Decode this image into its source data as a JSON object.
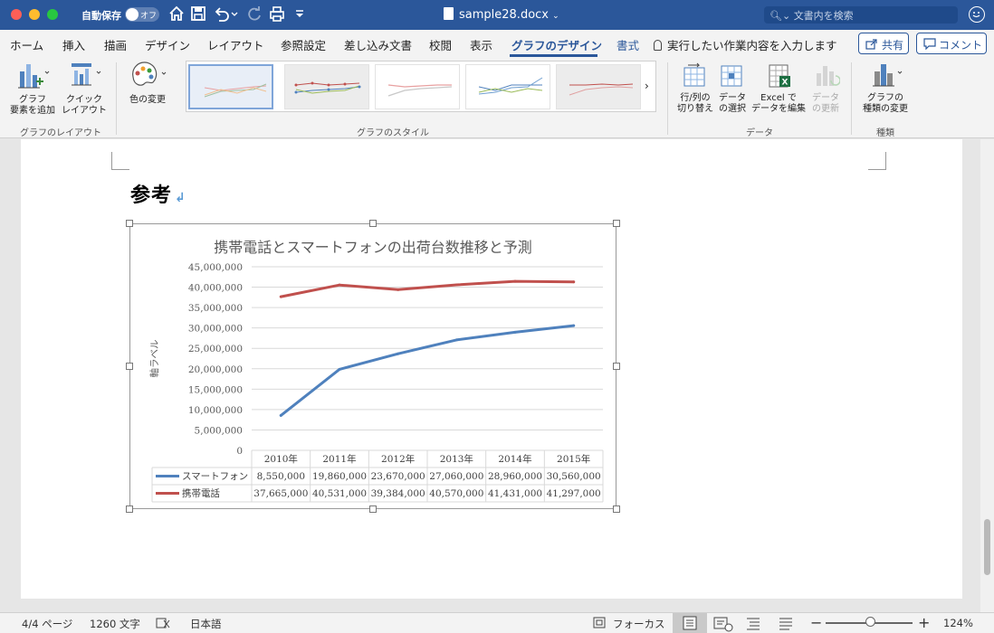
{
  "titlebar": {
    "autosave_label": "自動保存",
    "autosave_state": "オフ",
    "document_name": "sample28.docx",
    "search_placeholder": "文書内を検索"
  },
  "tabs": [
    {
      "label": "ホーム",
      "active": false
    },
    {
      "label": "挿入",
      "active": false
    },
    {
      "label": "描画",
      "active": false
    },
    {
      "label": "デザイン",
      "active": false
    },
    {
      "label": "レイアウト",
      "active": false
    },
    {
      "label": "参照設定",
      "active": false
    },
    {
      "label": "差し込み文書",
      "active": false
    },
    {
      "label": "校閲",
      "active": false
    },
    {
      "label": "表示",
      "active": false
    },
    {
      "label": "グラフのデザイン",
      "active": true
    },
    {
      "label": "書式",
      "active": false,
      "accent": true
    }
  ],
  "tell_me": "実行したい作業内容を入力します",
  "share_label": "共有",
  "comment_label": "コメント",
  "ribbon": {
    "add_element": [
      "グラフ",
      "要素を追加"
    ],
    "quick_layout": [
      "クイック",
      "レイアウト"
    ],
    "group_layout": "グラフのレイアウト",
    "change_colors": "色の変更",
    "group_styles": "グラフのスタイル",
    "switch_row_col": [
      "行/列の",
      "切り替え"
    ],
    "select_data": [
      "データ",
      "の選択"
    ],
    "edit_in_excel": [
      "Excel で",
      "データを編集"
    ],
    "refresh_data": [
      "データ",
      "の更新"
    ],
    "group_data": "データ",
    "change_type": [
      "グラフの",
      "種類の変更"
    ],
    "group_type": "種類"
  },
  "document": {
    "heading": "参考",
    "return_mark": "↲"
  },
  "chart_data": {
    "type": "line",
    "title": "携帯電話とスマートフォンの出荷台数推移と予測",
    "ylabel": "軸ラベル",
    "xlabel": "",
    "categories": [
      "2010年",
      "2011年",
      "2012年",
      "2013年",
      "2014年",
      "2015年"
    ],
    "ylim": [
      0,
      45000000
    ],
    "yticks": [
      "45,000,000",
      "40,000,000",
      "35,000,000",
      "30,000,000",
      "25,000,000",
      "20,000,000",
      "15,000,000",
      "10,000,000",
      "5,000,000",
      "0"
    ],
    "grid": true,
    "legend": "data-table",
    "series": [
      {
        "name": "スマートフォン",
        "color": "#4f81bd",
        "values": [
          8550000,
          19860000,
          23670000,
          27060000,
          28960000,
          30560000
        ],
        "labels": [
          "8,550,000",
          "19,860,000",
          "23,670,000",
          "27,060,000",
          "28,960,000",
          "30,560,000"
        ]
      },
      {
        "name": "携帯電話",
        "color": "#c0504d",
        "values": [
          37665000,
          40531000,
          39384000,
          40570000,
          41431000,
          41297000
        ],
        "labels": [
          "37,665,000",
          "40,531,000",
          "39,384,000",
          "40,570,000",
          "41,431,000",
          "41,297,000"
        ]
      }
    ]
  },
  "status": {
    "page": "4/4 ページ",
    "words": "1260 文字",
    "language": "日本語",
    "focus": "フォーカス",
    "zoom": "124%",
    "zoom_level": 0.5
  },
  "colors": {
    "brand": "#2b579a",
    "series_blue": "#4f81bd",
    "series_red": "#c0504d"
  }
}
